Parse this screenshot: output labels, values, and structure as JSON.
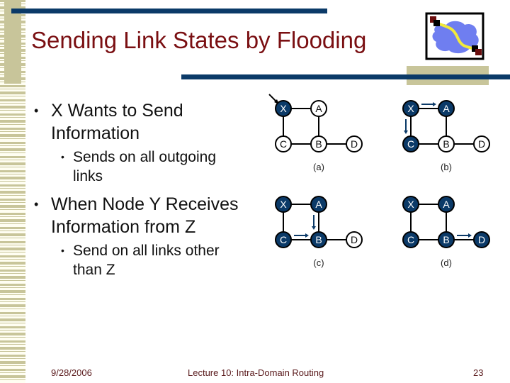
{
  "slide": {
    "title": "Sending Link States by Flooding",
    "logo_icon": "network-cloud-icon",
    "colors": {
      "title": "#7a0f12",
      "accent_rule": "#0b3a68",
      "tan_stripe": "#c8c59a",
      "node_fill_active": "#0b3a68",
      "node_fill_idle": "#ffffff",
      "cloud": "#6f7ef0",
      "link_highlight": "#f2ea3a",
      "endpoint": "#6b0d0d"
    }
  },
  "bullets": [
    {
      "text": "X Wants to Send Information",
      "line1": "X Wants to Send",
      "line2": "Information",
      "sub": [
        {
          "line1": "Sends on all outgoing",
          "line2": "links"
        }
      ]
    },
    {
      "text": "When Node Y Receives Information from Z",
      "line1": "When Node Y Receives",
      "line2": "Information from Z",
      "sub": [
        {
          "line1": "Send on all links other",
          "line2": "than Z"
        }
      ]
    }
  ],
  "diagrams": [
    {
      "caption": "(a)",
      "nodes": [
        {
          "id": "X",
          "label": "X",
          "active": true
        },
        {
          "id": "A",
          "label": "A",
          "active": false
        },
        {
          "id": "C",
          "label": "C",
          "active": false
        },
        {
          "id": "B",
          "label": "B",
          "active": false
        },
        {
          "id": "D",
          "label": "D",
          "active": false
        }
      ],
      "arrows": [
        {
          "into": "X",
          "from": "external"
        }
      ]
    },
    {
      "caption": "(b)",
      "nodes": [
        {
          "id": "X",
          "label": "X",
          "active": true
        },
        {
          "id": "A",
          "label": "A",
          "active": true
        },
        {
          "id": "C",
          "label": "C",
          "active": true
        },
        {
          "id": "B",
          "label": "B",
          "active": false
        },
        {
          "id": "D",
          "label": "D",
          "active": false
        }
      ],
      "arrows": [
        {
          "from": "X",
          "to": "A"
        },
        {
          "from": "X",
          "to": "C"
        }
      ]
    },
    {
      "caption": "(c)",
      "nodes": [
        {
          "id": "X",
          "label": "X",
          "active": true
        },
        {
          "id": "A",
          "label": "A",
          "active": true
        },
        {
          "id": "C",
          "label": "C",
          "active": true
        },
        {
          "id": "B",
          "label": "B",
          "active": true
        },
        {
          "id": "D",
          "label": "D",
          "active": false
        }
      ],
      "arrows": [
        {
          "from": "A",
          "to": "B"
        },
        {
          "from": "C",
          "to": "B"
        }
      ]
    },
    {
      "caption": "(d)",
      "nodes": [
        {
          "id": "X",
          "label": "X",
          "active": true
        },
        {
          "id": "A",
          "label": "A",
          "active": true
        },
        {
          "id": "C",
          "label": "C",
          "active": true
        },
        {
          "id": "B",
          "label": "B",
          "active": true
        },
        {
          "id": "D",
          "label": "D",
          "active": true
        }
      ],
      "arrows": [
        {
          "from": "B",
          "to": "D"
        }
      ]
    }
  ],
  "links": [
    [
      "X",
      "A"
    ],
    [
      "X",
      "C"
    ],
    [
      "A",
      "B"
    ],
    [
      "C",
      "B"
    ],
    [
      "B",
      "D"
    ]
  ],
  "footer": {
    "date": "9/28/2006",
    "course": "Lecture 10: Intra-Domain Routing",
    "page": "23"
  }
}
